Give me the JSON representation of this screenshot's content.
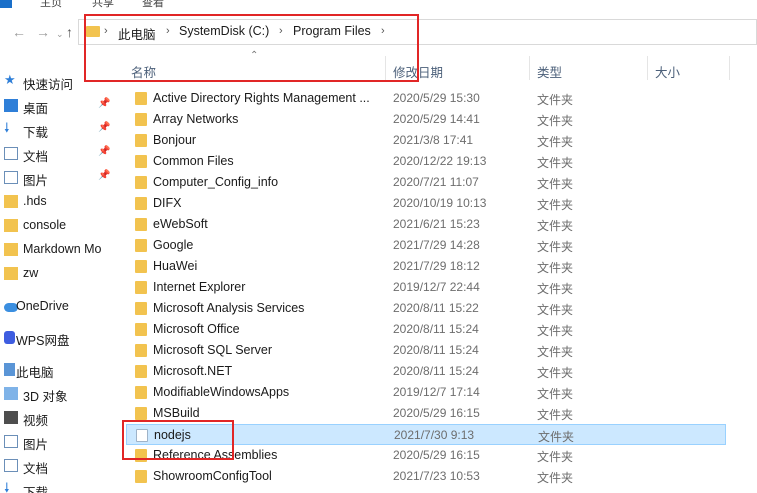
{
  "ribbon": {
    "tabs": [
      "主页",
      "共享",
      "查看"
    ]
  },
  "breadcrumb": {
    "items": [
      "此电脑",
      "SystemDisk (C:)",
      "Program Files"
    ]
  },
  "sidebar": {
    "items": [
      {
        "label": "快速访问",
        "icon": "star-icon",
        "pinned": false
      },
      {
        "label": "桌面",
        "icon": "desktop-icon",
        "pinned": true
      },
      {
        "label": "下载",
        "icon": "download-icon",
        "pinned": true
      },
      {
        "label": "文档",
        "icon": "document-icon",
        "pinned": true
      },
      {
        "label": "图片",
        "icon": "picture-icon",
        "pinned": true
      },
      {
        "label": ".hds",
        "icon": "folder-icon",
        "pinned": false
      },
      {
        "label": "console",
        "icon": "folder-icon",
        "pinned": false
      },
      {
        "label": "Markdown Mo",
        "icon": "folder-icon",
        "pinned": false
      },
      {
        "label": "zw",
        "icon": "folder-icon",
        "pinned": false
      },
      {
        "label": "OneDrive",
        "icon": "cloud-icon",
        "pinned": false
      },
      {
        "label": "WPS网盘",
        "icon": "wps-cloud-icon",
        "pinned": false
      },
      {
        "label": "此电脑",
        "icon": "this-pc-icon",
        "pinned": false
      },
      {
        "label": "3D 对象",
        "icon": "3d-objects-icon",
        "pinned": false
      },
      {
        "label": "视频",
        "icon": "video-icon",
        "pinned": false
      },
      {
        "label": "图片",
        "icon": "picture-icon",
        "pinned": false
      },
      {
        "label": "文档",
        "icon": "document-icon",
        "pinned": false
      },
      {
        "label": "下载",
        "icon": "download-icon",
        "pinned": false
      }
    ]
  },
  "columns": {
    "name": "名称",
    "modified": "修改日期",
    "type": "类型",
    "size": "大小"
  },
  "files": [
    {
      "name": "Active Directory Rights Management ...",
      "date": "2020/5/29 15:30",
      "type": "文件夹"
    },
    {
      "name": "Array Networks",
      "date": "2020/5/29 14:41",
      "type": "文件夹"
    },
    {
      "name": "Bonjour",
      "date": "2021/3/8 17:41",
      "type": "文件夹"
    },
    {
      "name": "Common Files",
      "date": "2020/12/22 19:13",
      "type": "文件夹"
    },
    {
      "name": "Computer_Config_info",
      "date": "2020/7/21 11:07",
      "type": "文件夹"
    },
    {
      "name": "DIFX",
      "date": "2020/10/19 10:13",
      "type": "文件夹"
    },
    {
      "name": "eWebSoft",
      "date": "2021/6/21 15:23",
      "type": "文件夹"
    },
    {
      "name": "Google",
      "date": "2021/7/29 14:28",
      "type": "文件夹"
    },
    {
      "name": "HuaWei",
      "date": "2021/7/29 18:12",
      "type": "文件夹"
    },
    {
      "name": "Internet Explorer",
      "date": "2019/12/7 22:44",
      "type": "文件夹"
    },
    {
      "name": "Microsoft Analysis Services",
      "date": "2020/8/11 15:22",
      "type": "文件夹"
    },
    {
      "name": "Microsoft Office",
      "date": "2020/8/11 15:24",
      "type": "文件夹"
    },
    {
      "name": "Microsoft SQL Server",
      "date": "2020/8/11 15:24",
      "type": "文件夹"
    },
    {
      "name": "Microsoft.NET",
      "date": "2020/8/11 15:24",
      "type": "文件夹"
    },
    {
      "name": "ModifiableWindowsApps",
      "date": "2019/12/7 17:14",
      "type": "文件夹"
    },
    {
      "name": "MSBuild",
      "date": "2020/5/29 16:15",
      "type": "文件夹"
    },
    {
      "name": "nodejs",
      "date": "2021/7/30 9:13",
      "type": "文件夹",
      "selected": true
    },
    {
      "name": "Reference Assemblies",
      "date": "2020/5/29 16:15",
      "type": "文件夹"
    },
    {
      "name": "ShowroomConfigTool",
      "date": "2021/7/23 10:53",
      "type": "文件夹"
    }
  ],
  "colors": {
    "folder": "#f2c34f",
    "selection": "#cce8ff",
    "annotation": "#e12626"
  }
}
